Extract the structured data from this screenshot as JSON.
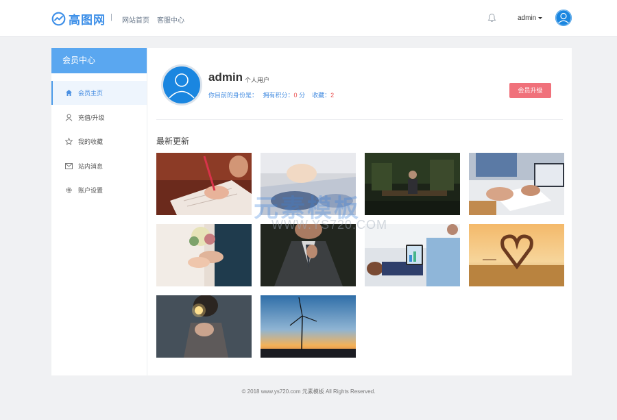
{
  "header": {
    "logo_text": "高图网",
    "separator": "|",
    "nav": [
      "网站首页",
      "客服中心"
    ],
    "user_name": "admin",
    "icons": {
      "logo": "logo-icon",
      "bell": "bell-icon",
      "avatar": "avatar"
    }
  },
  "sidebar": {
    "title": "会员中心",
    "items": [
      {
        "label": "会员主页",
        "icon": "home-icon",
        "active": true
      },
      {
        "label": "充值/升级",
        "icon": "user-icon",
        "active": false
      },
      {
        "label": "我的收藏",
        "icon": "star-icon",
        "active": false
      },
      {
        "label": "站内消息",
        "icon": "mail-icon",
        "active": false
      },
      {
        "label": "账户设置",
        "icon": "gear-icon",
        "active": false
      }
    ]
  },
  "profile": {
    "name": "admin",
    "type": "个人用户",
    "identity_label": "你目前的身份是：",
    "points_label": "拥有积分：",
    "points_value": "0",
    "points_unit": "分",
    "favorites_label": "收藏：",
    "favorites_value": "2",
    "upgrade_label": "会员升级"
  },
  "latest": {
    "title": "最新更新",
    "images": [
      "writing-hand-photo",
      "pen-paper-photo",
      "city-bench-photo",
      "laptop-writing-photo",
      "wedding-ring-photo",
      "suit-man-photo",
      "tablet-chart-photo",
      "heart-beach-photo",
      "sparkler-photo",
      "wind-turbine-photo"
    ]
  },
  "watermark": {
    "text": "元素模板",
    "url": "WWW.YS720.COM"
  },
  "footer": {
    "text": "© 2018 www.ys720.com 元素模板 All Rights Reserved."
  },
  "colors": {
    "accent": "#5aa7f0",
    "button": "#f0717b",
    "highlight": "#e84c4c",
    "link": "#4a90e2"
  }
}
